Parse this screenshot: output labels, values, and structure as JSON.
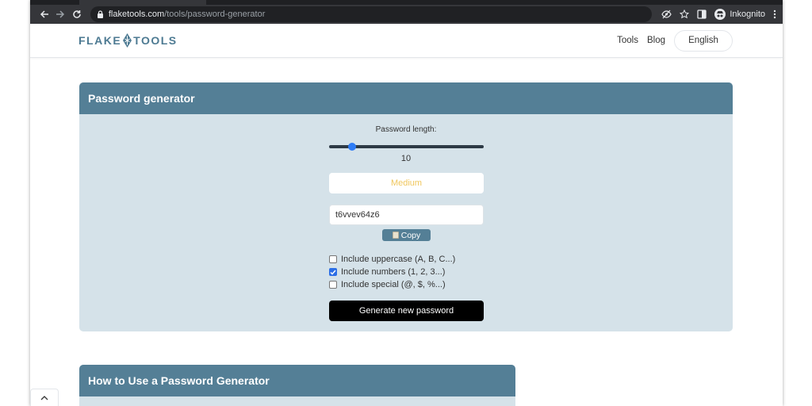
{
  "browser": {
    "url_host": "flaketools.com",
    "url_path": "/tools/password-generator",
    "profile_label": "Inkognito"
  },
  "site": {
    "logo_left": "FLAKE",
    "logo_right": "TOOLS",
    "nav": {
      "tools": "Tools",
      "blog": "Blog",
      "language": "English"
    }
  },
  "generator": {
    "title": "Password generator",
    "length_label": "Password length:",
    "length_value": "10",
    "length_slider_fraction": 0.13,
    "strength_label": "Medium",
    "strength_color": "#f0c75e",
    "password": "t6vvev64z6",
    "copy_label": "Copy",
    "options": [
      {
        "label": "Include uppercase (A, B, C...)",
        "checked": false
      },
      {
        "label": "Include numbers (1, 2, 3...)",
        "checked": true
      },
      {
        "label": "Include special (@, $, %...)",
        "checked": false
      }
    ],
    "generate_label": "Generate new password"
  },
  "howto": {
    "title": "How to Use a Password Generator"
  },
  "colors": {
    "accent": "#547f96",
    "card_bg": "#d5e2e9",
    "checkbox_checked": "#2c6ee6"
  }
}
